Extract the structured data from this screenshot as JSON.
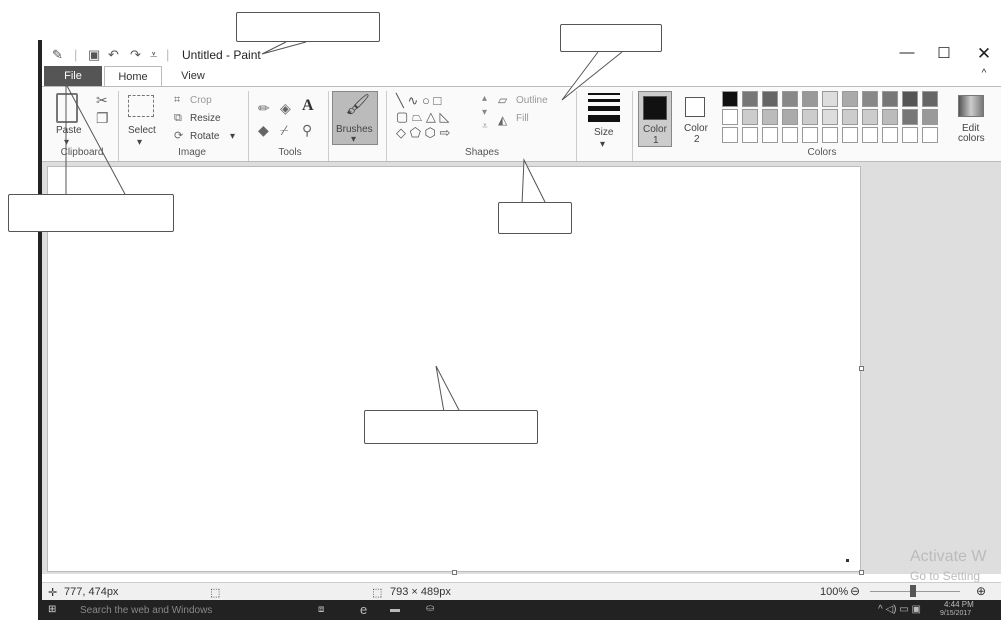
{
  "window": {
    "title": "Untitled - Paint",
    "minimize_icon": "minimize-icon",
    "maximize_icon": "maximize-icon",
    "close_icon": "close-icon"
  },
  "ribbon": {
    "tabs": [
      {
        "label": "File",
        "active": false
      },
      {
        "label": "Home",
        "active": true
      },
      {
        "label": "View",
        "active": false
      }
    ],
    "clipboard": {
      "paste_label": "Paste",
      "group_label": "Clipboard"
    },
    "image": {
      "select_label": "Select",
      "crop_label": "Crop",
      "resize_label": "Resize",
      "rotate_label": "Rotate",
      "group_label": "Image"
    },
    "tools": {
      "group_label": "Tools"
    },
    "brushes": {
      "label": "Brushes"
    },
    "shapes": {
      "outline_label": "Outline",
      "fill_label": "Fill",
      "group_label": "Shapes"
    },
    "size": {
      "label": "Size"
    },
    "colors": {
      "color1_label": "Color",
      "color1_number": "1",
      "color2_label": "Color",
      "color2_number": "2",
      "edit_label_1": "Edit",
      "edit_label_2": "colors",
      "group_label": "Colors",
      "color1_value": "#111111",
      "color2_value": "#ffffff"
    }
  },
  "status": {
    "cursor_position": "777, 474px",
    "canvas_size": "793 × 489px",
    "zoom": "100%"
  },
  "watermark": {
    "line1": "Activate W",
    "line2": "Go to Setting"
  },
  "taskbar": {
    "search_placeholder": "Search the web and Windows",
    "time": "4:44 PM",
    "date": "9/15/2017"
  }
}
